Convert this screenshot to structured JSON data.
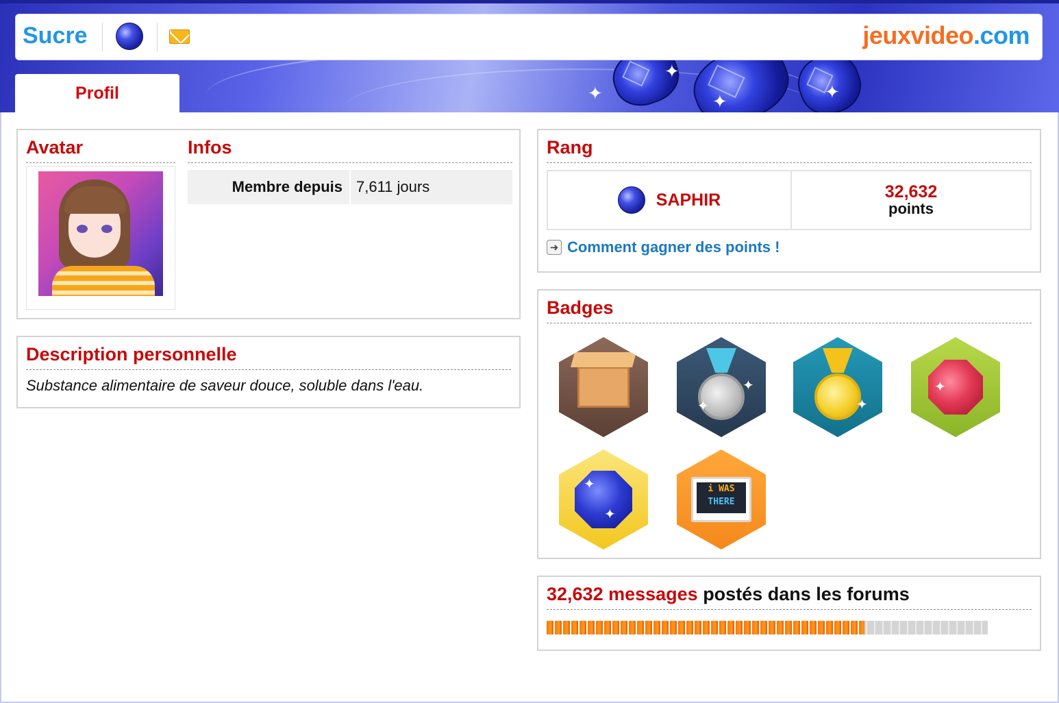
{
  "header": {
    "username": "Sucre",
    "logo_part1": "jeuxvideo",
    "logo_part2": ".com",
    "tab_profil": "Profil"
  },
  "avatar": {
    "title": "Avatar"
  },
  "infos": {
    "title": "Infos",
    "rows": [
      {
        "label": "Membre depuis",
        "value": "7,611 jours"
      }
    ]
  },
  "description": {
    "title": "Description personnelle",
    "text": "Substance alimentaire de saveur douce, soluble dans l'eau."
  },
  "rang": {
    "title": "Rang",
    "name": "SAPHIR",
    "points": "32,632",
    "points_label": "points",
    "howto_link": "Comment gagner des points !"
  },
  "badges": {
    "title": "Badges",
    "items": [
      "box-badge",
      "silver-medal-badge",
      "gold-medal-badge",
      "ruby-badge",
      "sapphire-badge",
      "i-was-there-badge"
    ],
    "tv_line1": "i WAS",
    "tv_line2": "THERE"
  },
  "messages": {
    "count": "32,632 messages",
    "suffix": " postés dans les forums",
    "progress": 0.72
  },
  "colors": {
    "accent_red": "#c50b0b",
    "link_blue": "#1c78c0",
    "header_blue": "#2a30b8",
    "logo_orange": "#f36e22",
    "logo_blue": "#2396e5"
  }
}
